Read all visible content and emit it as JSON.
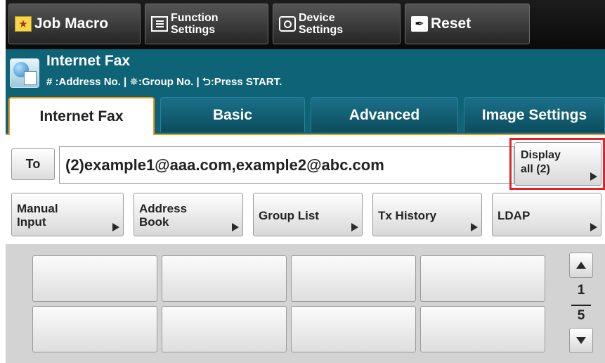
{
  "toolbar": {
    "job_macro": "Job Macro",
    "function_settings_line1": "Function",
    "function_settings_line2": "Settings",
    "device_settings_line1": "Device",
    "device_settings_line2": "Settings",
    "reset": "Reset"
  },
  "header": {
    "title": "Internet Fax",
    "subtitle": "# :Address No. | ✵:Group No. | ⮌:Press START."
  },
  "tabs": [
    {
      "label": "Internet Fax",
      "active": true
    },
    {
      "label": "Basic",
      "active": false
    },
    {
      "label": "Advanced",
      "active": false
    },
    {
      "label": "Image Settings",
      "active": false
    }
  ],
  "address": {
    "to_label": "To",
    "value": "(2)example1@aaa.com,example2@abc.com",
    "display_all_line1": "Display",
    "display_all_line2": "all (2)"
  },
  "modes": {
    "manual_input_line1": "Manual",
    "manual_input_line2": "Input",
    "address_book_line1": "Address",
    "address_book_line2": "Book",
    "group_list": "Group List",
    "tx_history": "Tx History",
    "ldap": "LDAP"
  },
  "pager": {
    "current": "1",
    "total": "5"
  },
  "colors": {
    "header_teal": "#0f6377",
    "active_tab_accent": "#f19a1f",
    "highlight_red": "#e0232e",
    "toolbar_black": "#111111"
  }
}
